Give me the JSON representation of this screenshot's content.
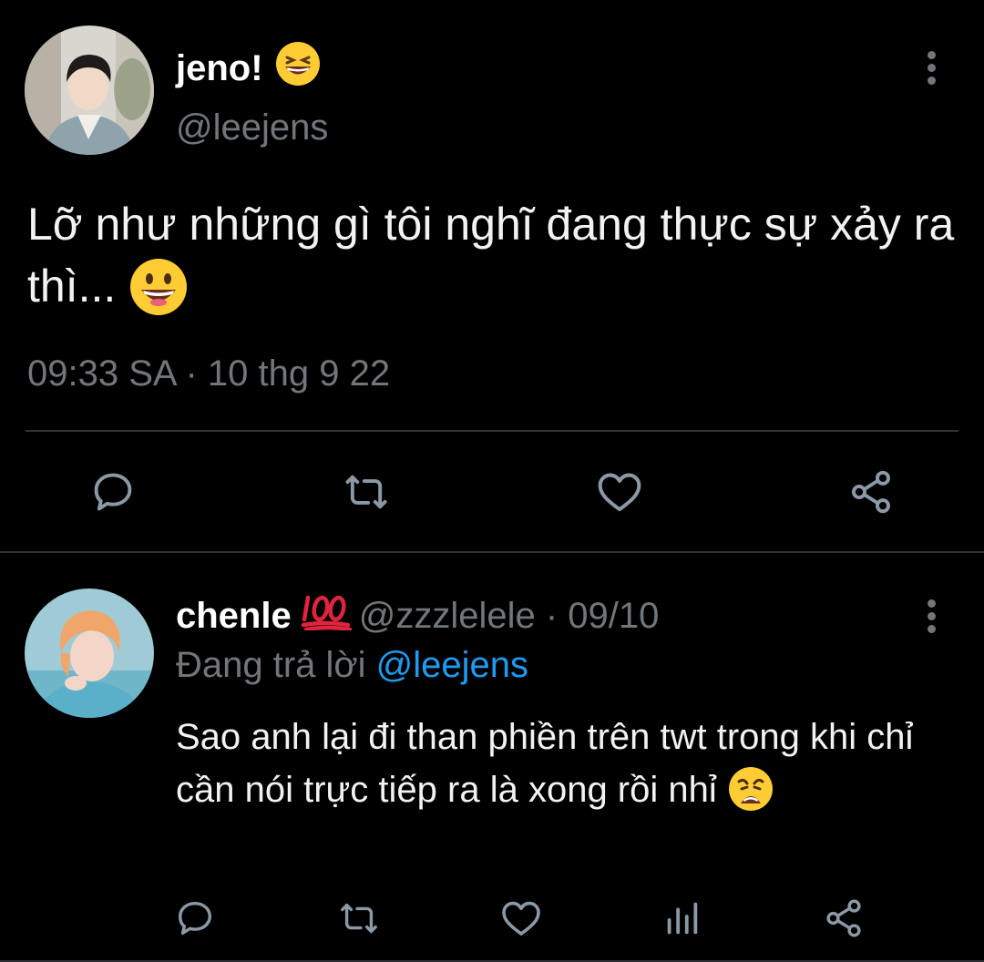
{
  "main_tweet": {
    "display_name": "jeno!",
    "name_emoji": "grinning-squinting-face",
    "handle": "@leejens",
    "text": "Lỡ như những gì tôi nghĩ đang thực sự xảy ra thì...",
    "text_emoji": "grinning-face",
    "timestamp": "09:33 SA · 10 thg 9 22",
    "actions": [
      "reply-icon",
      "retweet-icon",
      "like-icon",
      "share-icon"
    ]
  },
  "reply_tweet": {
    "display_name": "chenle",
    "name_emoji": "hundred-points",
    "handle": "@zzzlelele",
    "separator": " · ",
    "date": "09/10",
    "replying_label": "Đang trả lời ",
    "replying_mention": "@leejens",
    "text": "Sao anh lại đi than phiền trên twt trong khi chỉ cần nói trực tiếp ra là xong rồi nhỉ",
    "text_emoji": "weary-face",
    "actions": [
      "reply-icon",
      "retweet-icon",
      "like-icon",
      "analytics-icon",
      "share-icon"
    ]
  },
  "colors": {
    "background": "#000000",
    "text": "#e7e9ea",
    "muted": "#71767b",
    "link": "#1d9bf0",
    "divider": "#2f3336"
  }
}
